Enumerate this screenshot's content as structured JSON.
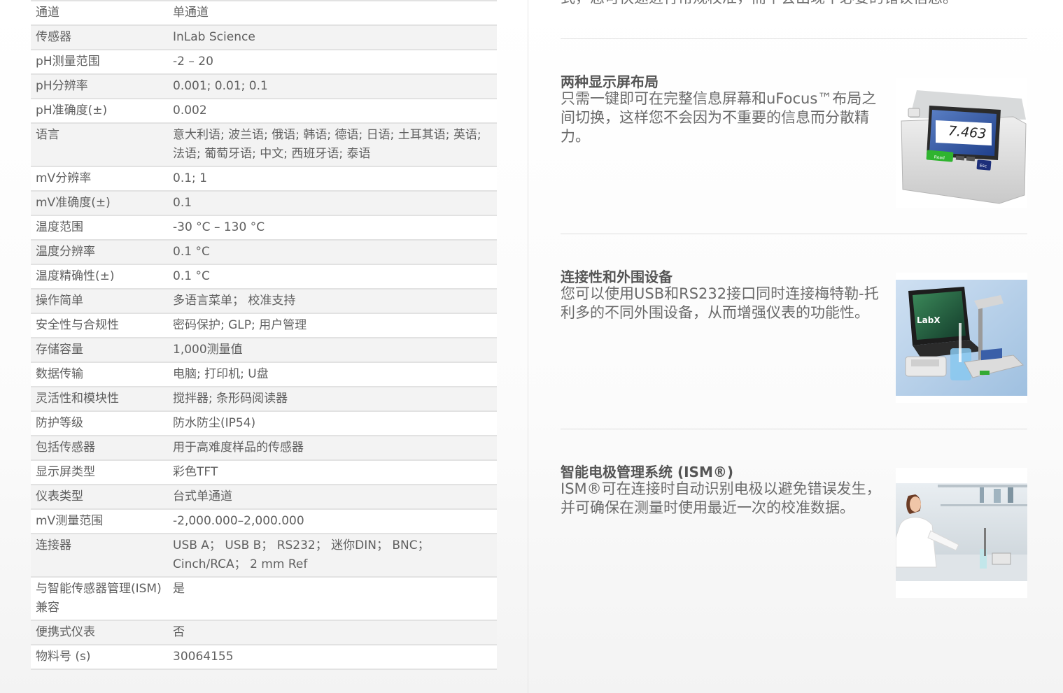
{
  "specs": [
    {
      "label": "通道",
      "value": "单通道"
    },
    {
      "label": "传感器",
      "value": "InLab Science"
    },
    {
      "label": "pH测量范围",
      "value": "-2 – 20"
    },
    {
      "label": "pH分辨率",
      "value": "0.001; 0.01; 0.1"
    },
    {
      "label": "pH准确度(±)",
      "value": "0.002"
    },
    {
      "label": "语言",
      "value": "意大利语; 波兰语; 俄语; 韩语; 德语; 日语; 土耳其语; 英语; 法语; 葡萄牙语; 中文; 西班牙语; 泰语"
    },
    {
      "label": "mV分辨率",
      "value": "0.1; 1"
    },
    {
      "label": "mV准确度(±)",
      "value": "0.1"
    },
    {
      "label": "温度范围",
      "value": "-30 °C – 130 °C"
    },
    {
      "label": "温度分辨率",
      "value": "0.1 °C"
    },
    {
      "label": "温度精确性(±)",
      "value": "0.1 °C"
    },
    {
      "label": "操作简单",
      "value": "多语言菜单；  校准支持"
    },
    {
      "label": "安全性与合规性",
      "value": "密码保护; GLP; 用户管理"
    },
    {
      "label": "存储容量",
      "value": "1,000测量值"
    },
    {
      "label": "数据传输",
      "value": "电脑; 打印机; U盘"
    },
    {
      "label": "灵活性和模块性",
      "value": "搅拌器; 条形码阅读器"
    },
    {
      "label": "防护等级",
      "value": "防水防尘(IP54)"
    },
    {
      "label": "包括传感器",
      "value": "用于高难度样品的传感器"
    },
    {
      "label": "显示屏类型",
      "value": "彩色TFT"
    },
    {
      "label": "仪表类型",
      "value": "台式单通道"
    },
    {
      "label": "mV测量范围",
      "value": "-2,000.000–2,000.000"
    },
    {
      "label": "连接器",
      "value": "USB A；  USB B；  RS232；  迷你DIN；  BNC；  Cinch/RCA；  2 mm Ref"
    },
    {
      "label": "与智能传感器管理(ISM)兼容",
      "value": "是"
    },
    {
      "label": "便携式仪表",
      "value": "否"
    },
    {
      "label": "物料号 (s)",
      "value": "30064155"
    }
  ],
  "intro_tail": "式，您可快速进行常规校准，而不会出现不必要的错误信息。",
  "features": [
    {
      "title": "两种显示屏布局",
      "description": "只需一键即可在完整信息屏幕和uFocus™布局之间切换，这样您不会因为不重要的信息而分散精力。",
      "meter_reading": "7.463",
      "button_read": "Read",
      "button_esc": "Esc"
    },
    {
      "title": "连接性和外围设备",
      "description": "您可以使用USB和RS232接口同时连接梅特勒-托利多的不同外围设备，从而增强仪表的功能性。",
      "screen_logo": "LabX"
    },
    {
      "title": "智能电极管理系统 (ISM®)",
      "description": "ISM®可在连接时自动识别电极以避免错误发生，并可确保在测量时使用最近一次的校准数据。"
    }
  ]
}
